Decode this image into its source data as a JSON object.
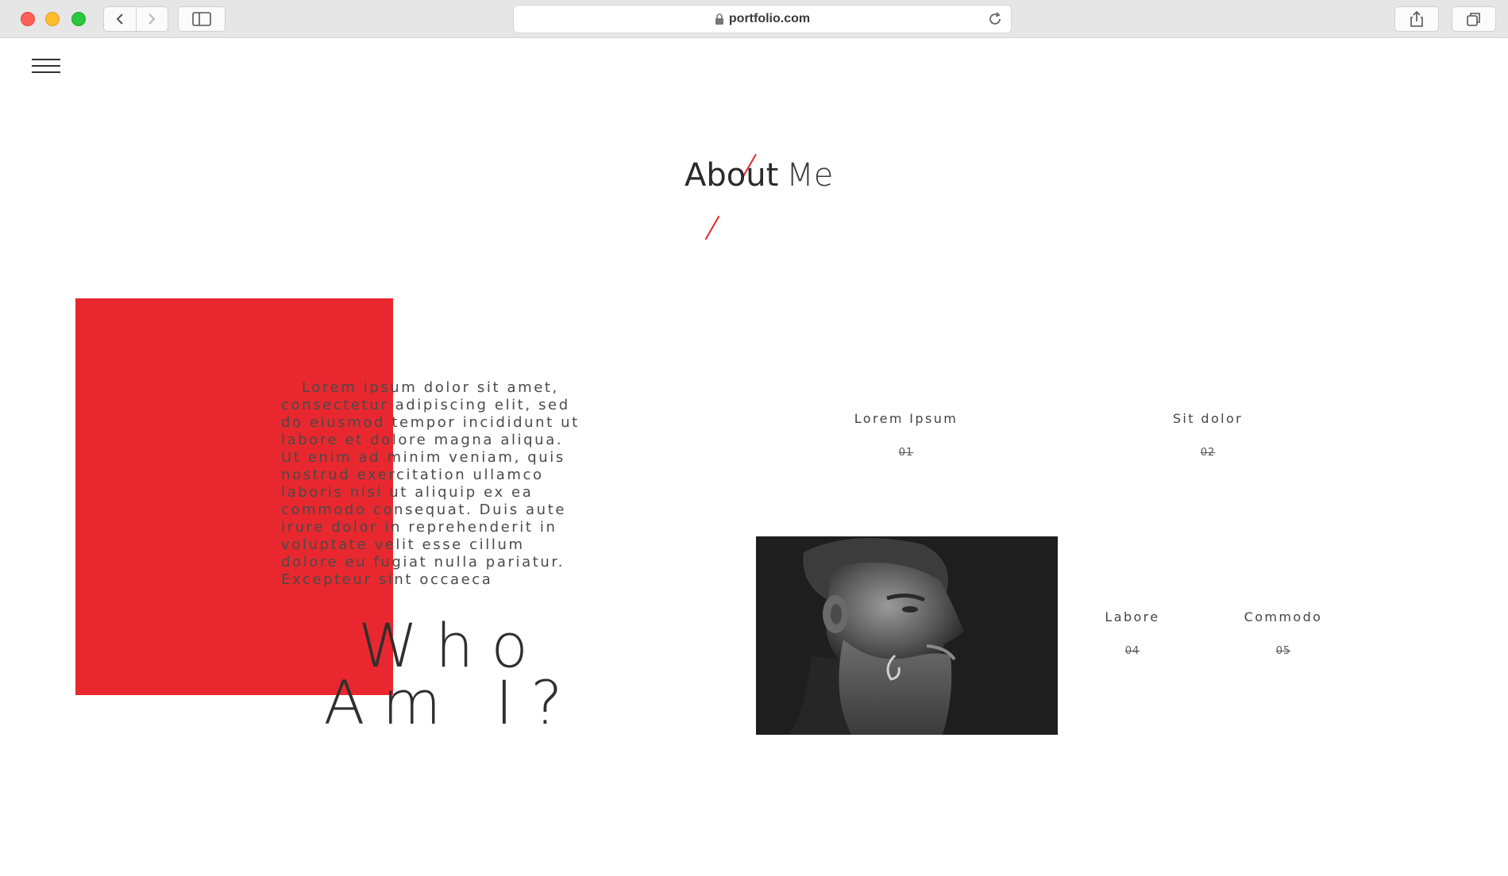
{
  "browser": {
    "url": "portfolio.com",
    "icons": {
      "close": "close-light",
      "minimize": "minimize-light",
      "zoom": "zoom-light",
      "back": "chevron-left-icon",
      "forward": "chevron-right-icon",
      "sidebar": "sidebar-icon",
      "lock": "lock-icon",
      "reload": "reload-icon",
      "share": "share-icon",
      "tabs": "tabs-icon"
    }
  },
  "page": {
    "title_strong": "About",
    "title_light": "Me",
    "intro": "Lorem ipsum dolor sit amet, consectetur adipiscing elit, sed do eiusmod tempor incididunt ut labore et dolore magna aliqua. Ut enim ad minim veniam, quis nostrud exercitation ullamco laboris nisi ut aliquip ex ea commodo consequat. Duis aute irure dolor in reprehenderit in voluptate velit esse cillum dolore eu fugiat nulla pariatur. Excepteur sint occaeca",
    "heading_line1": "Who",
    "heading_line2": "Am I?",
    "accent_color": "#e8282e",
    "stats": [
      {
        "label": "Lorem Ipsum",
        "number": "01"
      },
      {
        "label": "Sit dolor",
        "number": "02"
      },
      {
        "label": "Labore",
        "number": "04"
      },
      {
        "label": "Commodo",
        "number": "05"
      }
    ]
  }
}
